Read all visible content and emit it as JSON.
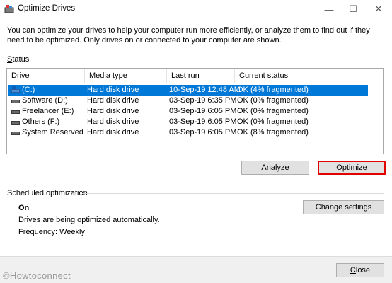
{
  "window": {
    "title": "Optimize Drives",
    "minimize_glyph": "—",
    "maximize_glyph": "☐",
    "close_glyph": "✕"
  },
  "intro": "You can optimize your drives to help your computer run more efficiently, or analyze them to find out if they need to be optimized. Only drives on or connected to your computer are shown.",
  "status_section": {
    "label_accel": "S",
    "label_rest": "tatus"
  },
  "columns": {
    "drive": "Drive",
    "media_type": "Media type",
    "last_run": "Last run",
    "current_status": "Current status"
  },
  "drives": [
    {
      "name": "(C:)",
      "media_type": "Hard disk drive",
      "last_run": "10-Sep-19 12:48 AM",
      "status": "OK (4% fragmented)",
      "selected": true,
      "icon": "system-drive-icon"
    },
    {
      "name": "Software (D:)",
      "media_type": "Hard disk drive",
      "last_run": "03-Sep-19 6:35 PM",
      "status": "OK (0% fragmented)",
      "selected": false,
      "icon": "hard-drive-icon"
    },
    {
      "name": "Freelancer (E:)",
      "media_type": "Hard disk drive",
      "last_run": "03-Sep-19 6:05 PM",
      "status": "OK (0% fragmented)",
      "selected": false,
      "icon": "hard-drive-icon"
    },
    {
      "name": "Others (F:)",
      "media_type": "Hard disk drive",
      "last_run": "03-Sep-19 6:05 PM",
      "status": "OK (0% fragmented)",
      "selected": false,
      "icon": "hard-drive-icon"
    },
    {
      "name": "System Reserved",
      "media_type": "Hard disk drive",
      "last_run": "03-Sep-19 6:05 PM",
      "status": "OK (8% fragmented)",
      "selected": false,
      "icon": "hard-drive-icon"
    }
  ],
  "buttons": {
    "analyze_accel": "A",
    "analyze_rest": "nalyze",
    "optimize_accel": "O",
    "optimize_rest": "ptimize",
    "change_settings": "Change settings",
    "close_accel": "C",
    "close_rest": "lose"
  },
  "scheduled": {
    "label": "Scheduled optimization",
    "state": "On",
    "description": "Drives are being optimized automatically.",
    "frequency": "Frequency: Weekly"
  },
  "watermark": "©Howtoconnect",
  "colors": {
    "selection": "#0078d7",
    "highlight_border": "#e00000"
  }
}
